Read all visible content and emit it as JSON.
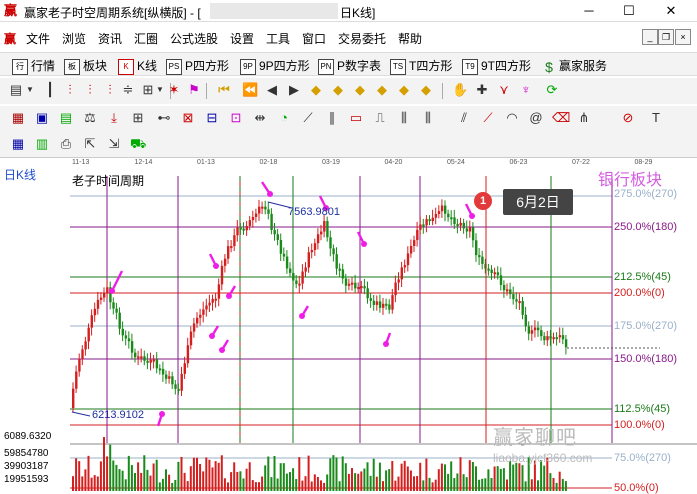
{
  "window": {
    "logo": "赢",
    "title": "赢家老子时空周期系统[纵横版] - [",
    "title_suffix": "日K线]"
  },
  "menu": [
    "文件",
    "浏览",
    "资讯",
    "汇圈",
    "公式选股",
    "设置",
    "工具",
    "窗口",
    "交易委托",
    "帮助"
  ],
  "toolbar1": [
    {
      "icon": "行",
      "label": "行情"
    },
    {
      "icon": "板",
      "label": "板块"
    },
    {
      "icon": "K",
      "label": "K线"
    },
    {
      "icon": "PS",
      "label": "P四方形"
    },
    {
      "icon": "9P",
      "label": "9P四方形"
    },
    {
      "icon": "PN",
      "label": "P数字表"
    },
    {
      "icon": "TS",
      "label": "T四方形"
    },
    {
      "icon": "T9",
      "label": "9T四方形"
    },
    {
      "icon": "$",
      "label": "赢家服务"
    }
  ],
  "chart": {
    "period_label": "日K线",
    "indicator_name": "老子时间周期",
    "time_strip": [
      "11-13",
      "12-14",
      "01-13",
      "02-18",
      "03-19",
      "04-20",
      "05-24",
      "06-23",
      "07-22",
      "08-29"
    ],
    "high_label": "7563.9801",
    "low_label": "6213.9102",
    "tooltip_badge": "1",
    "tooltip_date": "6月2日",
    "sector_title": "银行板块",
    "levels": [
      {
        "text": "275.0%(270)",
        "color": "#9ab0c8"
      },
      {
        "text": "250.0%(180)",
        "color": "#8a1a8a"
      },
      {
        "text": "212.5%(45)",
        "color": "#1a7a1a"
      },
      {
        "text": "200.0%(0)",
        "color": "#d41f1f"
      },
      {
        "text": "175.0%(270)",
        "color": "#9ab0c8"
      },
      {
        "text": "150.0%(180)",
        "color": "#8a1a8a"
      },
      {
        "text": "112.5%(45)",
        "color": "#1a7a1a"
      },
      {
        "text": "100.0%(0)",
        "color": "#d41f1f"
      },
      {
        "text": "75.0%(270)",
        "color": "#9ab0c8"
      },
      {
        "text": "50.0%(0)",
        "color": "#d41f1f"
      }
    ],
    "volume_labels": [
      "6089.6320",
      "59854780",
      "39903187",
      "19951593"
    ],
    "watermark_main": "赢家聊吧",
    "watermark_url": "liaoba.yjcf360.com"
  }
}
